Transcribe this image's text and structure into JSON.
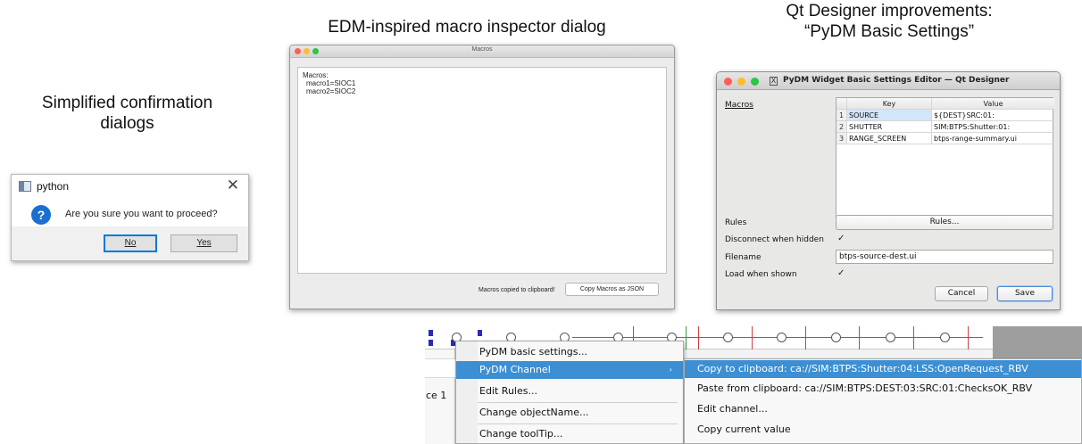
{
  "captions": {
    "confirm": [
      "Simplified confirmation",
      "dialogs"
    ],
    "macro": "EDM-inspired macro inspector dialog",
    "qt": [
      "Qt Designer improvements:",
      "“PyDM Basic Settings”"
    ]
  },
  "confirm_dialog": {
    "title": "python",
    "close_glyph": "✕",
    "icon": "question-icon",
    "icon_glyph": "?",
    "message": "Are you sure you want to proceed?",
    "buttons": {
      "no": "No",
      "yes": "Yes"
    }
  },
  "macro_dialog": {
    "title": "Macros",
    "header": "Macros:",
    "lines": [
      "macro1=SIOC1",
      "macro2=SIOC2"
    ],
    "status": "Macros copied to clipboard!",
    "copy_button": "Copy Macros as JSON",
    "traffic_lights": [
      "#ff5f57",
      "#febc2e",
      "#28c840"
    ]
  },
  "qt_dialog": {
    "title": "PyDM Widget Basic Settings Editor — Qt Designer",
    "close_glyph": "X",
    "macros_label": "Macros",
    "table": {
      "columns": [
        "Key",
        "Value"
      ],
      "rows": [
        {
          "index": "1",
          "key": "SOURCE",
          "value": "${DEST}SRC:01:"
        },
        {
          "index": "2",
          "key": "SHUTTER",
          "value": "SIM:BTPS:Shutter:01:"
        },
        {
          "index": "3",
          "key": "RANGE_SCREEN",
          "value": "btps-range-summary.ui"
        }
      ]
    },
    "rules_label": "Rules",
    "rules_button": "Rules...",
    "disconnect_label": "Disconnect when hidden",
    "disconnect_checked": "✓",
    "filename_label": "Filename",
    "filename_value": "btps-source-dest.ui",
    "load_label": "Load when shown",
    "load_checked": "✓",
    "cancel_button": "Cancel",
    "save_button": "Save"
  },
  "context_menu": {
    "left_label": "ce 1",
    "items": [
      {
        "label": "PyDM basic settings..."
      },
      {
        "label": "PyDM Channel",
        "submenu": true,
        "arrow": "›"
      },
      {
        "label": "Edit Rules..."
      },
      {
        "label": "Change objectName..."
      },
      {
        "label": "Change toolTip..."
      }
    ],
    "submenu": [
      "Copy to clipboard: ca://SIM:BTPS:Shutter:04:LSS:OpenRequest_RBV",
      "Paste from clipboard: ca://SIM:BTPS:DEST:03:SRC:01:ChecksOK_RBV",
      "Edit channel...",
      "Copy current value"
    ],
    "highlight_color": "#3c8fd3"
  }
}
